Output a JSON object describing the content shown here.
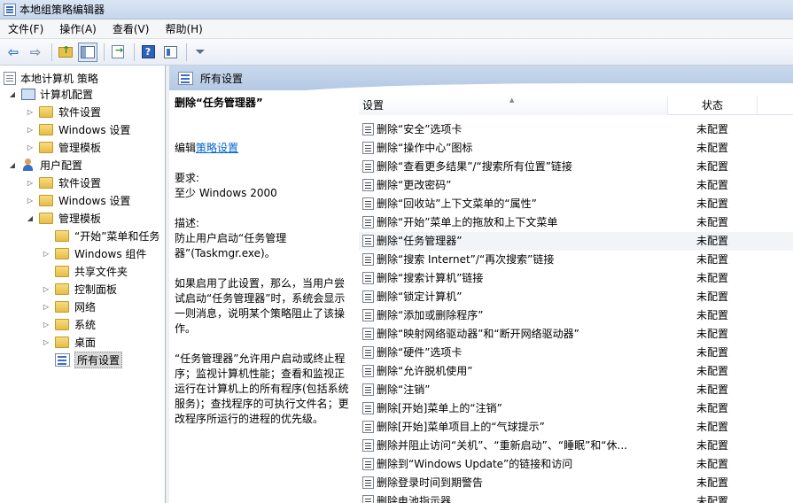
{
  "window": {
    "title": "本地组策略编辑器"
  },
  "menu": [
    "文件(F)",
    "操作(A)",
    "查看(V)",
    "帮助(H)"
  ],
  "tree": [
    {
      "label": "本地计算机 策略",
      "icon": "policy-doc-icon",
      "level": 0,
      "expander": ""
    },
    {
      "label": "计算机配置",
      "icon": "computer-icon",
      "level": 1,
      "expander": "◢"
    },
    {
      "label": "软件设置",
      "icon": "folder-icon",
      "level": 2,
      "expander": "▷"
    },
    {
      "label": "Windows 设置",
      "icon": "folder-icon",
      "level": 2,
      "expander": "▷"
    },
    {
      "label": "管理模板",
      "icon": "folder-icon",
      "level": 2,
      "expander": "▷"
    },
    {
      "label": "用户配置",
      "icon": "user-icon",
      "level": 1,
      "expander": "◢"
    },
    {
      "label": "软件设置",
      "icon": "folder-icon",
      "level": 2,
      "expander": "▷"
    },
    {
      "label": "Windows 设置",
      "icon": "folder-icon",
      "level": 2,
      "expander": "▷"
    },
    {
      "label": "管理模板",
      "icon": "folder-icon",
      "level": 2,
      "expander": "◢"
    },
    {
      "label": "“开始”菜单和任务",
      "icon": "folder-icon",
      "level": 3,
      "expander": ""
    },
    {
      "label": "Windows 组件",
      "icon": "folder-icon",
      "level": 3,
      "expander": "▷"
    },
    {
      "label": "共享文件夹",
      "icon": "folder-icon",
      "level": 3,
      "expander": ""
    },
    {
      "label": "控制面板",
      "icon": "folder-icon",
      "level": 3,
      "expander": "▷"
    },
    {
      "label": "网络",
      "icon": "folder-icon",
      "level": 3,
      "expander": "▷"
    },
    {
      "label": "系统",
      "icon": "folder-icon",
      "level": 3,
      "expander": "▷"
    },
    {
      "label": "桌面",
      "icon": "folder-icon",
      "level": 3,
      "expander": "▷"
    },
    {
      "label": "所有设置",
      "icon": "all-settings-icon",
      "level": 3,
      "expander": "",
      "selected": true
    }
  ],
  "right_header": {
    "title": "所有设置"
  },
  "description": {
    "title": "删除“任务管理器”",
    "edit_prefix": "编辑",
    "edit_link": "策略设置",
    "req_label": "要求:",
    "req_value": "至少 Windows 2000",
    "desc_label": "描述:",
    "desc_1": "防止用户启动“任务管理器”(Taskmgr.exe)。",
    "desc_2": "如果启用了此设置，那么，当用户尝试启动“任务管理器”时，系统会显示一则消息，说明某个策略阻止了该操作。",
    "desc_3": "“任务管理器”允许用户启动或终止程序；监视计算机性能；查看和监视正运行在计算机上的所有程序(包括系统服务)；查找程序的可执行文件名；更改程序所运行的进程的优先级。"
  },
  "columns": {
    "setting": "设置",
    "state": "状态"
  },
  "settings": [
    {
      "name": "删除“安全”选项卡",
      "state": "未配置"
    },
    {
      "name": "删除“操作中心”图标",
      "state": "未配置"
    },
    {
      "name": "删除“查看更多结果”/“搜索所有位置”链接",
      "state": "未配置"
    },
    {
      "name": "删除“更改密码”",
      "state": "未配置"
    },
    {
      "name": "删除“回收站”上下文菜单的“属性”",
      "state": "未配置"
    },
    {
      "name": "删除“开始”菜单上的拖放和上下文菜单",
      "state": "未配置"
    },
    {
      "name": "删除“任务管理器”",
      "state": "未配置",
      "highlight": true
    },
    {
      "name": "删除“搜索 Internet”/“再次搜索”链接",
      "state": "未配置"
    },
    {
      "name": "删除“搜索计算机”链接",
      "state": "未配置"
    },
    {
      "name": "删除“锁定计算机”",
      "state": "未配置"
    },
    {
      "name": "删除“添加或删除程序”",
      "state": "未配置"
    },
    {
      "name": "删除“映射网络驱动器”和“断开网络驱动器”",
      "state": "未配置"
    },
    {
      "name": "删除“硬件”选项卡",
      "state": "未配置"
    },
    {
      "name": "删除“允许脱机使用”",
      "state": "未配置"
    },
    {
      "name": "删除“注销”",
      "state": "未配置"
    },
    {
      "name": "删除[开始]菜单上的“注销”",
      "state": "未配置"
    },
    {
      "name": "删除[开始]菜单项目上的“气球提示”",
      "state": "未配置"
    },
    {
      "name": "删除并阻止访问“关机”、“重新启动”、“睡眠”和“休...",
      "state": "未配置"
    },
    {
      "name": "删除到“Windows Update”的链接和访问",
      "state": "未配置"
    },
    {
      "name": "删除登录时间到期警告",
      "state": "未配置"
    },
    {
      "name": "删除电池指示器",
      "state": "未配置"
    }
  ]
}
